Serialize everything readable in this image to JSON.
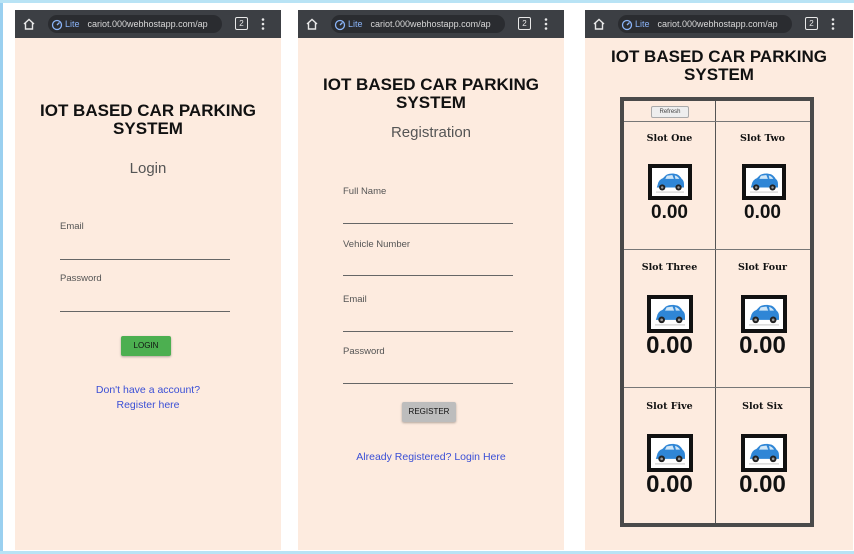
{
  "browser": {
    "mode_label": "Lite",
    "url": "cariot.000webhostapp.com/ap",
    "tab_count": "2"
  },
  "app_title_line1": "IOT BASED CAR PARKING",
  "app_title_line2": "SYSTEM",
  "login": {
    "heading": "Login",
    "email_label": "Email",
    "password_label": "Password",
    "button": "LOGIN",
    "link_line1": "Don't have a account?",
    "link_line2": "Register here"
  },
  "registration": {
    "heading": "Registration",
    "full_name_label": "Full Name",
    "vehicle_label": "Vehicle Number",
    "email_label": "Email",
    "password_label": "Password",
    "button": "REGISTER",
    "link": "Already Registered? Login Here"
  },
  "dashboard": {
    "refresh_label": "Refresh",
    "slots": [
      {
        "name": "Slot One",
        "value": "0.00"
      },
      {
        "name": "Slot Two",
        "value": "0.00"
      },
      {
        "name": "Slot Three",
        "value": "0.00"
      },
      {
        "name": "Slot Four",
        "value": "0.00"
      },
      {
        "name": "Slot Five",
        "value": "0.00"
      },
      {
        "name": "Slot Six",
        "value": "0.00"
      }
    ]
  },
  "colors": {
    "page_bg": "#fdebdf",
    "login_button": "#4caf50",
    "register_button": "#bdbdbd",
    "link": "#3a4fd6",
    "car": "#2f86d6"
  },
  "icons": [
    "home-icon",
    "lite-icon",
    "tab-switcher-icon",
    "menu-icon",
    "car-icon"
  ]
}
